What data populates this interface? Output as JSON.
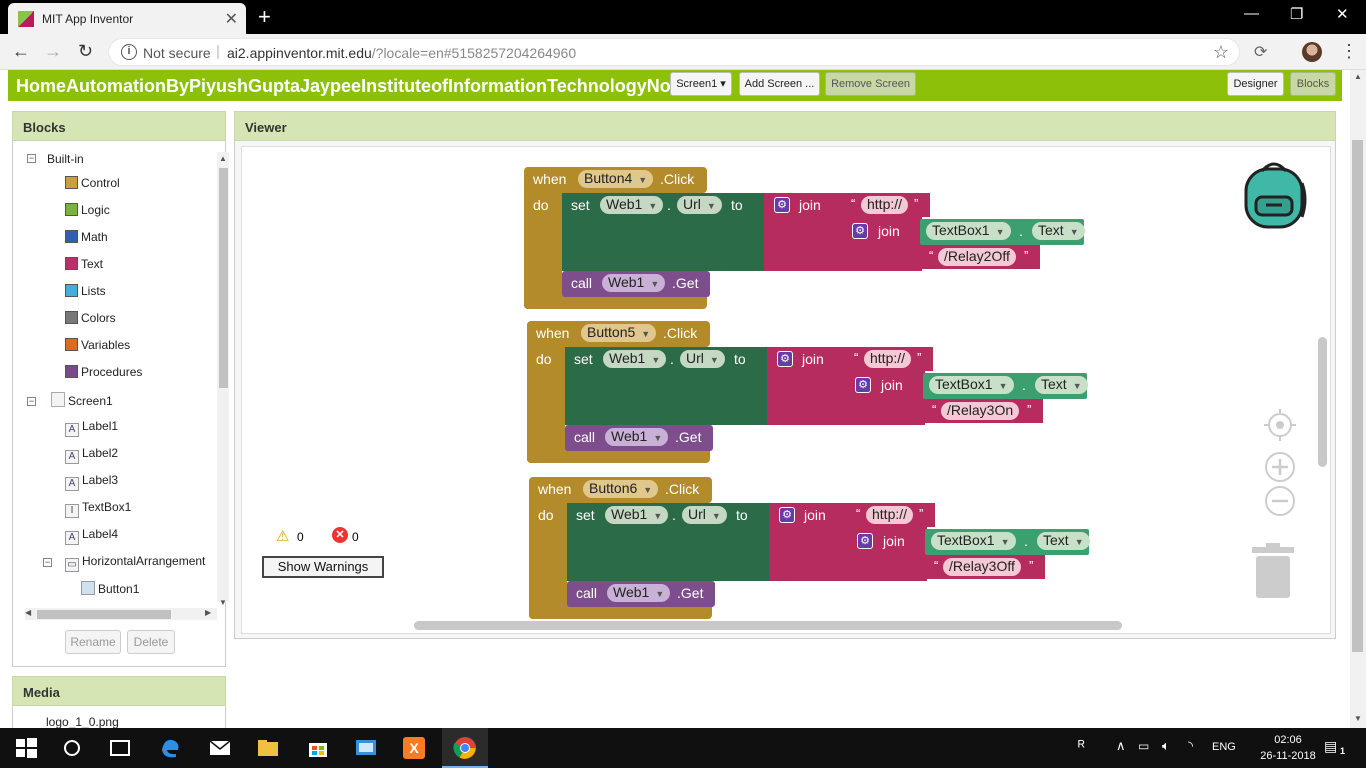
{
  "browser": {
    "tab_title": "MIT App Inventor",
    "not_secure": "Not secure",
    "url_host": "ai2.appinventor.mit.edu",
    "url_path": "/?locale=en#5158257204264960"
  },
  "header": {
    "project_title": "HomeAutomationByPiyushGuptaJaypeeInstituteofInformationTechnologyNoida",
    "screen_dropdown": "Screen1 ▾",
    "add_screen": "Add Screen ...",
    "remove_screen": "Remove Screen",
    "designer": "Designer",
    "blocks": "Blocks"
  },
  "blocks_panel": {
    "title": "Blocks",
    "builtin": "Built-in",
    "builtin_items": [
      {
        "label": "Control",
        "color": "#c8a040"
      },
      {
        "label": "Logic",
        "color": "#78b440"
      },
      {
        "label": "Math",
        "color": "#3060b0"
      },
      {
        "label": "Text",
        "color": "#b8306a"
      },
      {
        "label": "Lists",
        "color": "#40b0d8"
      },
      {
        "label": "Colors",
        "color": "#777777"
      },
      {
        "label": "Variables",
        "color": "#e06a20"
      },
      {
        "label": "Procedures",
        "color": "#7a4a8c"
      }
    ],
    "screen": "Screen1",
    "components": [
      {
        "label": "Label1",
        "icon": "A"
      },
      {
        "label": "Label2",
        "icon": "A"
      },
      {
        "label": "Label3",
        "icon": "A"
      },
      {
        "label": "TextBox1",
        "icon": "I"
      },
      {
        "label": "Label4",
        "icon": "A"
      }
    ],
    "arrangement": "HorizontalArrangement",
    "button1": "Button1",
    "rename": "Rename",
    "delete": "Delete"
  },
  "media_panel": {
    "title": "Media",
    "file": "logo_1_0.png"
  },
  "viewer": {
    "title": "Viewer",
    "warnings_count": "0",
    "errors_count": "0",
    "show_warnings": "Show Warnings"
  },
  "block_words": {
    "when": "when",
    "click": ".Click",
    "do": "do",
    "set": "set",
    "url": "Url",
    "to": "to",
    "join": "join",
    "call": "call",
    "get": ".Get",
    "web": "Web1",
    "http": "http://",
    "textbox": "TextBox1",
    "text": "Text",
    "dot": "."
  },
  "event_blocks": [
    {
      "button": "Button4",
      "path": "/Relay2Off"
    },
    {
      "button": "Button5",
      "path": "/Relay3On"
    },
    {
      "button": "Button6",
      "path": "/Relay3Off"
    }
  ],
  "taskbar": {
    "lang": "ENG",
    "time": "02:06",
    "date": "26-11-2018",
    "notifications": "1"
  }
}
